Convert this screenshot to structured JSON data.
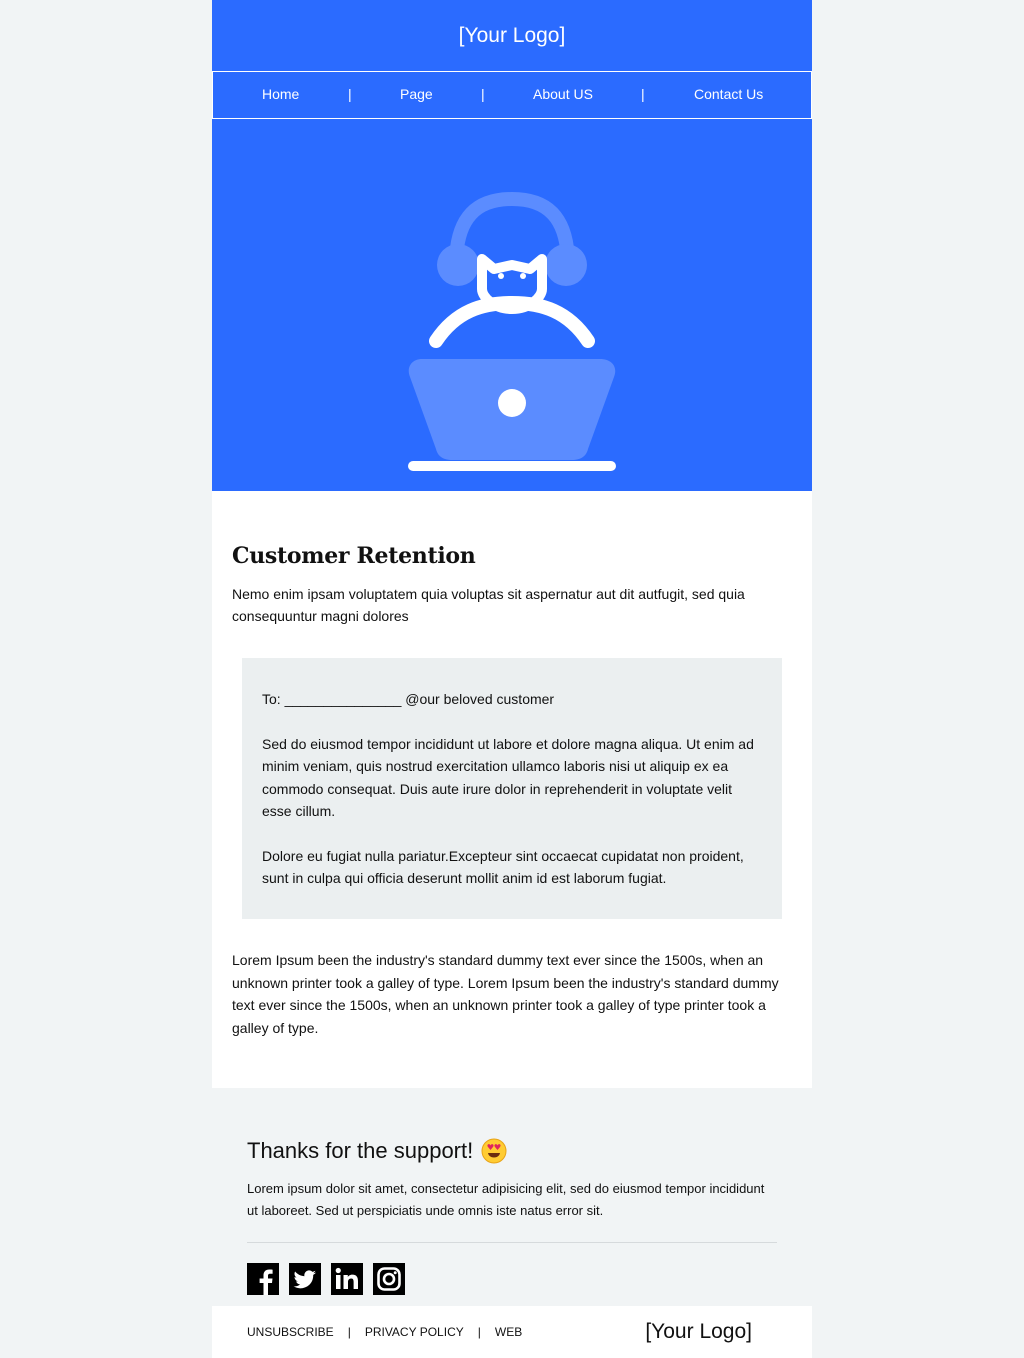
{
  "header": {
    "logo": "[Your Logo]"
  },
  "nav": {
    "items": [
      "Home",
      "Page",
      "About US",
      "Contact Us"
    ],
    "separator": "|"
  },
  "hero": {
    "icon": "customer-support-agent-laptop-icon"
  },
  "content": {
    "title": "Customer Retention",
    "intro": "Nemo enim ipsam voluptatem quia voluptas sit aspernatur aut dit autfugit, sed quia consequuntur magni dolores",
    "letter": {
      "to": "To: _______________ @our beloved customer",
      "p1": "Sed do eiusmod tempor incididunt ut labore et dolore magna aliqua. Ut enim ad minim veniam, quis nostrud exercitation ullamco laboris nisi ut aliquip ex ea commodo consequat. Duis aute irure dolor in reprehenderit in voluptate velit esse cillum.",
      "p2": "Dolore eu fugiat nulla pariatur.Excepteur sint occaecat cupidatat non proident, sunt in culpa qui officia deserunt mollit anim id est laborum fugiat."
    },
    "outro": "Lorem Ipsum been the industry's standard dummy text ever since the 1500s, when an unknown printer took a galley of type. Lorem Ipsum been the industry's standard dummy text ever since the 1500s, when an unknown printer took a galley of type printer took a galley of type."
  },
  "footer": {
    "thanks": "Thanks for the support!",
    "emoji": "heart-eyes-emoji",
    "text": "Lorem ipsum dolor sit amet, consectetur adipisicing elit, sed do eiusmod tempor incididunt ut laboreet. Sed ut perspiciatis unde omnis iste natus error sit.",
    "social": [
      "facebook-icon",
      "twitter-icon",
      "linkedin-icon",
      "instagram-icon"
    ]
  },
  "bottom": {
    "links": [
      "UNSUBSCRIBE",
      "PRIVACY POLICY",
      "WEB"
    ],
    "separator": "|",
    "logo": "[Your Logo]"
  },
  "colors": {
    "brand_blue": "#2b6bff",
    "hero_light_blue": "#5b8cff",
    "letter_bg": "#ebeff0",
    "page_bg": "#f1f4f5"
  }
}
